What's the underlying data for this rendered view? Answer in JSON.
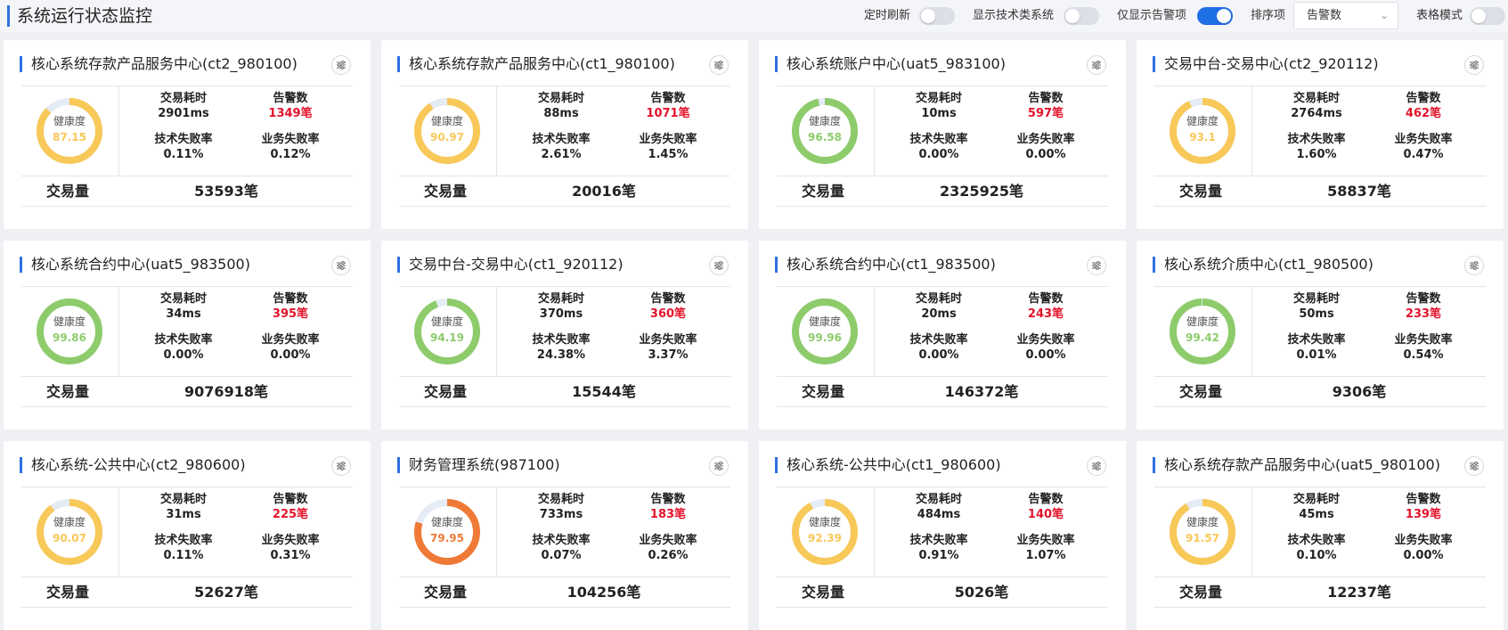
{
  "header": {
    "title": "系统运行状态监控",
    "controls": {
      "auto_refresh": {
        "label": "定时刷新",
        "on": false
      },
      "show_tech": {
        "label": "显示技术类系统",
        "on": false
      },
      "alerts_only": {
        "label": "仅显示告警项",
        "on": true
      },
      "sort": {
        "label": "排序项",
        "value": "告警数"
      },
      "table_mode": {
        "label": "表格模式",
        "on": false
      }
    }
  },
  "labels": {
    "gauge": "健康度",
    "latency": "交易耗时",
    "alerts": "告警数",
    "tech_fail": "技术失败率",
    "biz_fail": "业务失败率",
    "volume": "交易量"
  },
  "colors": {
    "accent": "#2f6fe0",
    "alert": "#e3132a",
    "green": "#8dcb6b",
    "yellow": "#f8c858",
    "orange": "#ef7a37",
    "track": "#e6ecf5"
  },
  "cards": [
    {
      "title": "核心系统存款产品服务中心(ct2_980100)",
      "health": "87.15",
      "level": "yellow",
      "latency": "2901ms",
      "alerts": "1349笔",
      "tech_fail": "0.11%",
      "biz_fail": "0.12%",
      "volume": "53593笔"
    },
    {
      "title": "核心系统存款产品服务中心(ct1_980100)",
      "health": "90.97",
      "level": "yellow",
      "latency": "88ms",
      "alerts": "1071笔",
      "tech_fail": "2.61%",
      "biz_fail": "1.45%",
      "volume": "20016笔"
    },
    {
      "title": "核心系统账户中心(uat5_983100)",
      "health": "96.58",
      "level": "green",
      "latency": "10ms",
      "alerts": "597笔",
      "tech_fail": "0.00%",
      "biz_fail": "0.00%",
      "volume": "2325925笔"
    },
    {
      "title": "交易中台-交易中心(ct2_920112)",
      "health": "93.1",
      "level": "yellow",
      "latency": "2764ms",
      "alerts": "462笔",
      "tech_fail": "1.60%",
      "biz_fail": "0.47%",
      "volume": "58837笔"
    },
    {
      "title": "核心系统合约中心(uat5_983500)",
      "health": "99.86",
      "level": "green",
      "latency": "34ms",
      "alerts": "395笔",
      "tech_fail": "0.00%",
      "biz_fail": "0.00%",
      "volume": "9076918笔"
    },
    {
      "title": "交易中台-交易中心(ct1_920112)",
      "health": "94.19",
      "level": "green",
      "latency": "370ms",
      "alerts": "360笔",
      "tech_fail": "24.38%",
      "biz_fail": "3.37%",
      "volume": "15544笔"
    },
    {
      "title": "核心系统合约中心(ct1_983500)",
      "health": "99.96",
      "level": "green",
      "latency": "20ms",
      "alerts": "243笔",
      "tech_fail": "0.00%",
      "biz_fail": "0.00%",
      "volume": "146372笔"
    },
    {
      "title": "核心系统介质中心(ct1_980500)",
      "health": "99.42",
      "level": "green",
      "latency": "50ms",
      "alerts": "233笔",
      "tech_fail": "0.01%",
      "biz_fail": "0.54%",
      "volume": "9306笔"
    },
    {
      "title": "核心系统-公共中心(ct2_980600)",
      "health": "90.07",
      "level": "yellow",
      "latency": "31ms",
      "alerts": "225笔",
      "tech_fail": "0.11%",
      "biz_fail": "0.31%",
      "volume": "52627笔"
    },
    {
      "title": "财务管理系统(987100)",
      "health": "79.95",
      "level": "orange",
      "latency": "733ms",
      "alerts": "183笔",
      "tech_fail": "0.07%",
      "biz_fail": "0.26%",
      "volume": "104256笔"
    },
    {
      "title": "核心系统-公共中心(ct1_980600)",
      "health": "92.39",
      "level": "yellow",
      "latency": "484ms",
      "alerts": "140笔",
      "tech_fail": "0.91%",
      "biz_fail": "1.07%",
      "volume": "5026笔"
    },
    {
      "title": "核心系统存款产品服务中心(uat5_980100)",
      "health": "91.57",
      "level": "yellow",
      "latency": "45ms",
      "alerts": "139笔",
      "tech_fail": "0.10%",
      "biz_fail": "0.00%",
      "volume": "12237笔"
    }
  ]
}
